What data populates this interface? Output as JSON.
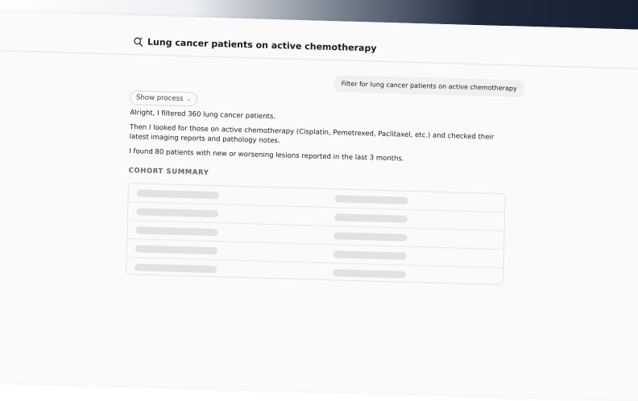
{
  "header": {
    "title": "Lung cancer patients on active chemotherapy",
    "icon": "search-sparkle-icon"
  },
  "conversation": {
    "user_query": "Filter for lung cancer patients on active chemotherapy",
    "show_process_label": "Show process",
    "messages": [
      "Alright, I filtered 360 lung cancer patients.",
      "Then I looked for those on active chemotherapy (Cisplatin, Pemetrexed, Paclitaxel, etc.) and checked their latest imaging reports and pathology notes.",
      "I found 80 patients with new or worsening lesions reported in the last 3 months."
    ]
  },
  "cohort_summary": {
    "title": "COHORT SUMMARY",
    "row_count": 5,
    "state": "loading"
  },
  "colors": {
    "accent_icon": "#d9534f",
    "skeleton": "#e2e2e2"
  }
}
